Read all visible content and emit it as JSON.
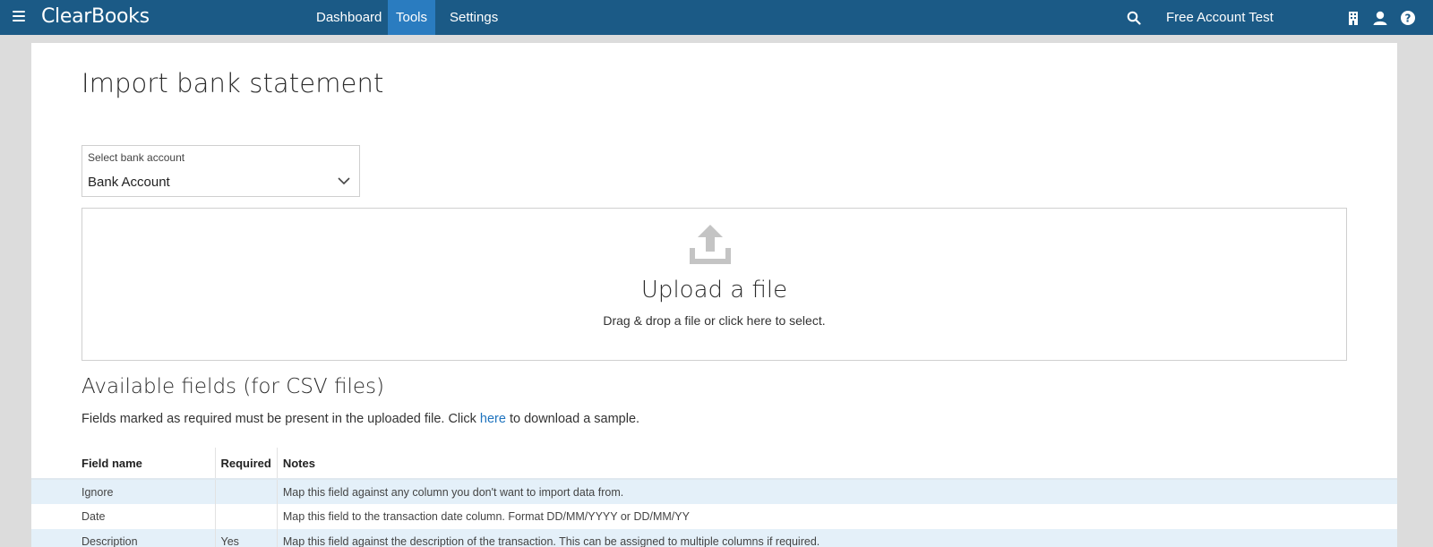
{
  "app": {
    "logo": "ClearBooks"
  },
  "nav": {
    "items": [
      {
        "label": "Dashboard",
        "active": false
      },
      {
        "label": "Tools",
        "active": true
      },
      {
        "label": "Settings",
        "active": false
      }
    ],
    "account_name": "Free Account Test"
  },
  "page": {
    "title": "Import bank statement",
    "select": {
      "label": "Select bank account",
      "value": "Bank Account"
    },
    "upload": {
      "title": "Upload a file",
      "subtitle": "Drag & drop a file or click here to select."
    },
    "fields_section": {
      "title": "Available fields (for CSV files)",
      "desc_before": "Fields marked as required must be present in the uploaded file. Click ",
      "desc_link": "here",
      "desc_after": " to download a sample.",
      "columns": [
        "Field name",
        "Required",
        "Notes"
      ],
      "rows": [
        {
          "field": "Ignore",
          "required": "",
          "notes": "Map this field against any column you don't want to import data from."
        },
        {
          "field": "Date",
          "required": "",
          "notes": "Map this field to the transaction date column. Format DD/MM/YYYY or DD/MM/YY"
        },
        {
          "field": "Description",
          "required": "Yes",
          "notes": "Map this field against the description of the transaction. This can be assigned to multiple columns if required."
        }
      ]
    }
  },
  "colors": {
    "topbar": "#1b5a86",
    "active_tab": "#2a7cc0",
    "link": "#1e73be",
    "row_highlight": "#e4f0f9"
  },
  "icons": [
    "menu-icon",
    "search-icon",
    "building-icon",
    "user-icon",
    "help-icon",
    "chevron-down-icon",
    "upload-icon"
  ]
}
